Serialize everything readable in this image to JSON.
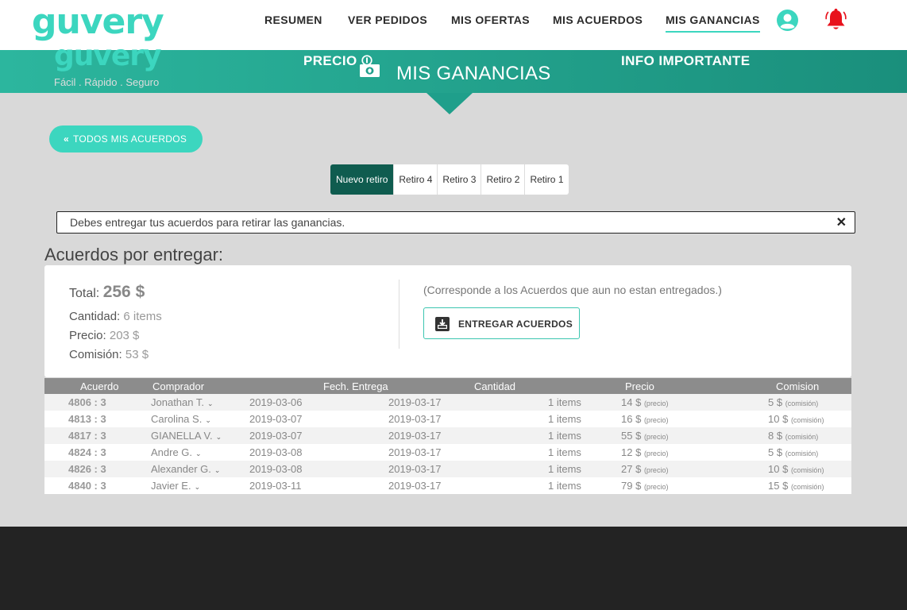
{
  "nav": {
    "logo": "guvery",
    "items": [
      "RESUMEN",
      "VER PEDIDOS",
      "MIS OFERTAS",
      "MIS ACUERDOS",
      "MIS GANANCIAS"
    ],
    "user_icon": "user-circle-icon",
    "bell_icon": "bell-icon",
    "accent_color": "#3cd6bf",
    "bell_color": "#e8121c"
  },
  "banner": {
    "title": "MIS GANANCIAS",
    "icon": "money-icon"
  },
  "back_button": {
    "label": "TODOS MIS ACUERDOS",
    "icon": "«"
  },
  "tabs": [
    "Nuevo retiro",
    "Retiro 4",
    "Retiro 3",
    "Retiro 2",
    "Retiro 1"
  ],
  "alert": {
    "text": "Debes entregar tus acuerdos para retirar las ganancias.",
    "close": "✕"
  },
  "section_title": "Acuerdos por entregar:",
  "summary": {
    "total_label": "Total:",
    "total_value": "256 $",
    "cantidad_label": "Cantidad:",
    "cantidad_value": "6 items",
    "precio_label": "Precio:",
    "precio_value": "203 $",
    "comision_label": "Comisión:",
    "comision_value": "53 $",
    "note": "(Corresponde a los Acuerdos que aun no estan entregados.)",
    "deliver_button": "ENTREGAR ACUERDOS"
  },
  "table": {
    "headers": [
      "Acuerdo",
      "Comprador",
      "Fech. Entrega",
      "Cantidad",
      "Precio",
      "Comision"
    ],
    "price_suffix": "(precio)",
    "commission_suffix": "(comisión)",
    "rows": [
      {
        "id": "4806 : 3",
        "buyer": "Jonathan T.",
        "date1": "2019-03-06",
        "date2": "2019-03-17",
        "qty": "1 items",
        "price": "14 $",
        "comm": "5 $"
      },
      {
        "id": "4813 : 3",
        "buyer": "Carolina S.",
        "date1": "2019-03-07",
        "date2": "2019-03-17",
        "qty": "1 items",
        "price": "16 $",
        "comm": "10 $"
      },
      {
        "id": "4817 : 3",
        "buyer": "GIANELLA V.",
        "date1": "2019-03-07",
        "date2": "2019-03-17",
        "qty": "1 items",
        "price": "55 $",
        "comm": "8 $"
      },
      {
        "id": "4824 : 3",
        "buyer": "Andre G.",
        "date1": "2019-03-08",
        "date2": "2019-03-17",
        "qty": "1 items",
        "price": "12 $",
        "comm": "5 $"
      },
      {
        "id": "4826 : 3",
        "buyer": "Alexander G.",
        "date1": "2019-03-08",
        "date2": "2019-03-17",
        "qty": "1 items",
        "price": "27 $",
        "comm": "10 $"
      },
      {
        "id": "4840 : 3",
        "buyer": "Javier E.",
        "date1": "2019-03-11",
        "date2": "2019-03-17",
        "qty": "1 items",
        "price": "79 $",
        "comm": "15 $"
      }
    ]
  },
  "footer": {
    "logo": "guvery",
    "tagline": "Fácil . Rápido . Seguro",
    "col1": "PRECIO",
    "col2": "INFO IMPORTANTE"
  }
}
